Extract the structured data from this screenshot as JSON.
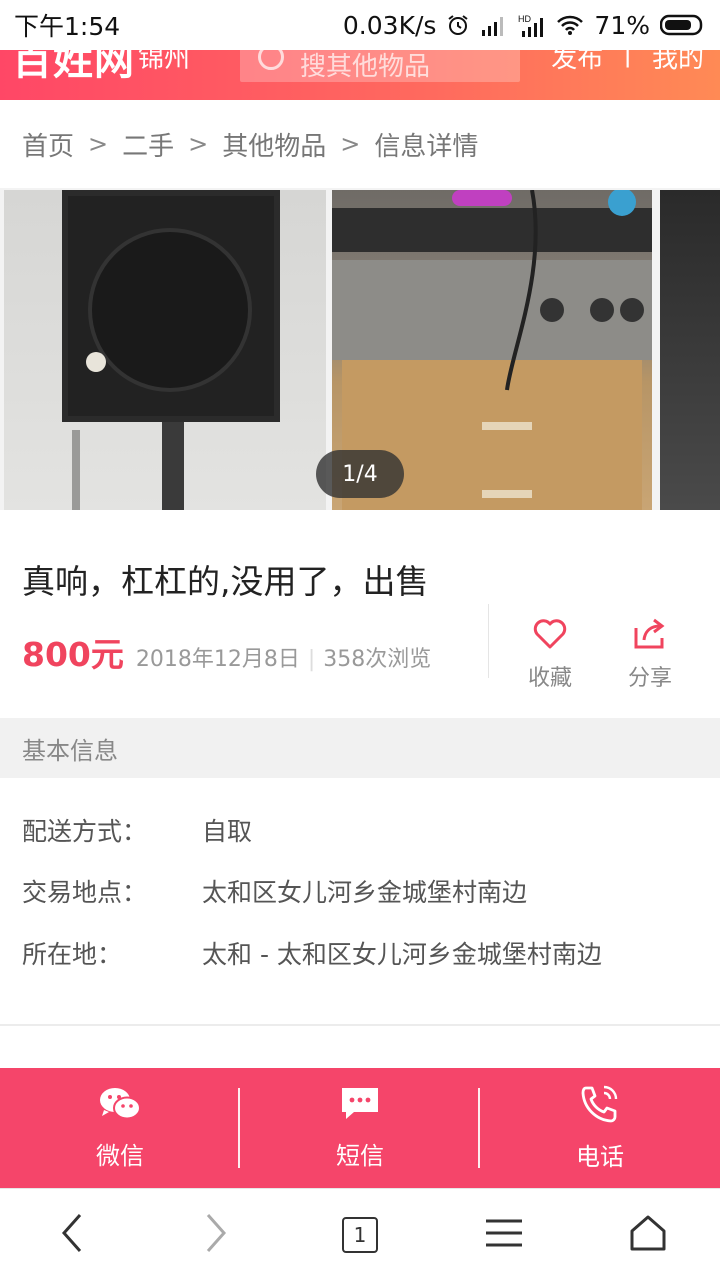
{
  "status_bar": {
    "time": "下午1:54",
    "speed": "0.03K/s",
    "battery": "71%"
  },
  "site_header": {
    "logo": "百姓网",
    "city": "锦州",
    "search_placeholder": "搜其他物品",
    "post_link": "发布",
    "mine_link": "我的"
  },
  "breadcrumb": [
    "首页",
    "二手",
    "其他物品",
    "信息详情"
  ],
  "gallery": {
    "counter": "1/4"
  },
  "listing": {
    "title": "真响，杠杠的,没用了，出售",
    "price": "800元",
    "date": "2018年12月8日",
    "views": "358次浏览"
  },
  "actions": {
    "favorite": "收藏",
    "share": "分享"
  },
  "section": {
    "title": "基本信息"
  },
  "info": [
    {
      "key": "配送方式：",
      "value": "自取"
    },
    {
      "key": "交易地点：",
      "value": "太和区女儿河乡金城堡村南边"
    },
    {
      "key": "所在地：",
      "value": "太和 - 太和区女儿河乡金城堡村南边"
    }
  ],
  "contact_bar": {
    "wechat": "微信",
    "sms": "短信",
    "phone": "电话"
  },
  "browser_nav": {
    "tab_count": "1"
  },
  "colors": {
    "accent": "#f5456a",
    "price": "#f0445e"
  }
}
